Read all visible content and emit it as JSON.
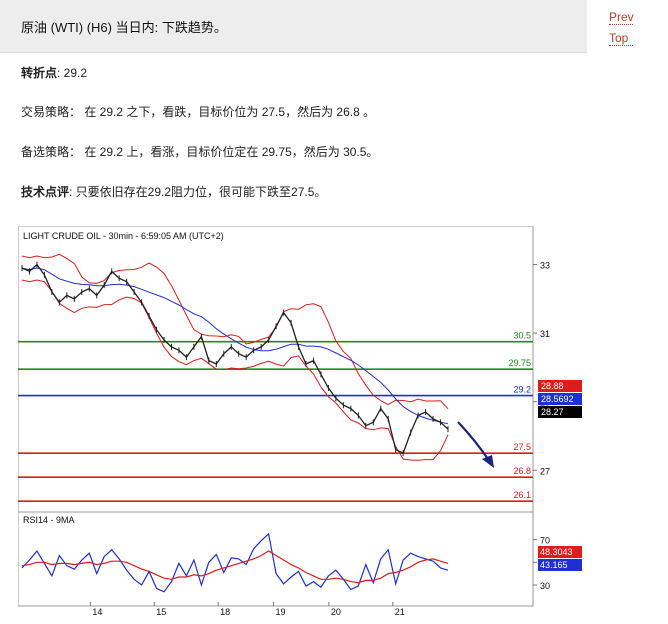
{
  "header": {
    "title": "原油 (WTI) (H6) 当日内: 下跌趋势。"
  },
  "nav": {
    "prev": "Prev",
    "top": "Top"
  },
  "analysis": {
    "pivot_label": "转折点",
    "pivot_value": ": 29.2",
    "strategy_label": "交易策略：",
    "strategy_text": " 在 29.2 之下，看跌，目标价位为 27.5，然后为 26.8 。",
    "alt_label": "备选策略：",
    "alt_text": " 在 29.2 上，看涨，目标价位定在 29.75，然后为 30.5。",
    "comment_label": "技术点评",
    "comment_text": ": 只要依旧存在29.2阻力位，很可能下跌至27.5。"
  },
  "chart_data": [
    {
      "type": "line",
      "title": "LIGHT CRUDE OIL - 30min - 6:59:05 AM (UTC+2)",
      "ylim": [
        25.9,
        33.6
      ],
      "y_ticks": [
        "33",
        "31",
        "29",
        "27"
      ],
      "x_ticks": [
        "14",
        "15",
        "18",
        "19",
        "20",
        "21"
      ],
      "levels": [
        {
          "label": "30.5",
          "value": 30.75,
          "color": "#1a8f1a"
        },
        {
          "label": "29.75",
          "value": 29.95,
          "color": "#1a8f1a"
        },
        {
          "label": "29.2",
          "value": 29.18,
          "color": "#1f2fd6"
        },
        {
          "label": "27.5",
          "value": 27.5,
          "color": "#e01b1b"
        },
        {
          "label": "26.8",
          "value": 26.8,
          "color": "#e01b1b"
        },
        {
          "label": "26.1",
          "value": 26.1,
          "color": "#e01b1b"
        }
      ],
      "price_tags": [
        {
          "label": "28.88",
          "color": "#e01b1b"
        },
        {
          "label": "28.5692",
          "color": "#1f2fd6"
        },
        {
          "label": "28.27",
          "color": "#000000"
        }
      ],
      "series": [
        {
          "values": [
            32.9,
            32.8,
            33.0,
            32.7,
            32.2,
            31.9,
            32.1,
            32.0,
            32.2,
            32.3,
            32.1,
            32.4,
            32.8,
            32.6,
            32.5,
            32.2,
            31.9,
            31.5,
            31.1,
            30.8,
            30.6,
            30.5,
            30.3,
            30.6,
            30.9,
            30.2,
            30.1,
            30.4,
            30.6,
            30.4,
            30.3,
            30.5,
            30.6,
            30.8,
            31.2,
            31.6,
            31.3,
            30.6,
            30.1,
            30.2,
            29.8,
            29.4,
            29.1,
            28.9,
            28.8,
            28.6,
            28.3,
            28.4,
            28.8,
            28.5,
            27.6,
            27.5,
            28.1,
            28.6,
            28.7,
            28.5,
            28.4,
            28.2
          ],
          "color": "#222222"
        }
      ]
    },
    {
      "type": "line",
      "title": "RSI14 - 9MA",
      "ylim": [
        15,
        82
      ],
      "y_ticks": [
        "70",
        "50",
        "30"
      ],
      "price_tags": [
        {
          "label": "48.3043",
          "color": "#e01b1b"
        },
        {
          "label": "43.165",
          "color": "#1f2fd6"
        }
      ],
      "series": [
        {
          "values": [
            45,
            52,
            60,
            49,
            38,
            56,
            47,
            44,
            52,
            58,
            40,
            55,
            61,
            53,
            43,
            35,
            30,
            42,
            27,
            24,
            33,
            49,
            38,
            52,
            30,
            50,
            57,
            41,
            54,
            53,
            48,
            62,
            69,
            75,
            40,
            31,
            37,
            42,
            29,
            33,
            28,
            38,
            43,
            35,
            26,
            29,
            48,
            32,
            53,
            61,
            31,
            52,
            58,
            55,
            53,
            51,
            45,
            43
          ],
          "color": "#1f2fd6"
        },
        {
          "values": [
            47,
            48,
            50,
            50,
            48,
            49,
            49,
            48,
            49,
            50,
            48,
            49,
            51,
            51,
            50,
            47,
            44,
            42,
            39,
            36,
            35,
            37,
            37,
            39,
            38,
            40,
            43,
            45,
            47,
            49,
            51,
            53,
            56,
            60,
            56,
            52,
            48,
            45,
            41,
            38,
            35,
            35,
            36,
            35,
            33,
            32,
            34,
            34,
            36,
            40,
            41,
            43,
            46,
            50,
            52,
            53,
            51,
            49
          ],
          "color": "#e01b1b"
        }
      ]
    }
  ]
}
